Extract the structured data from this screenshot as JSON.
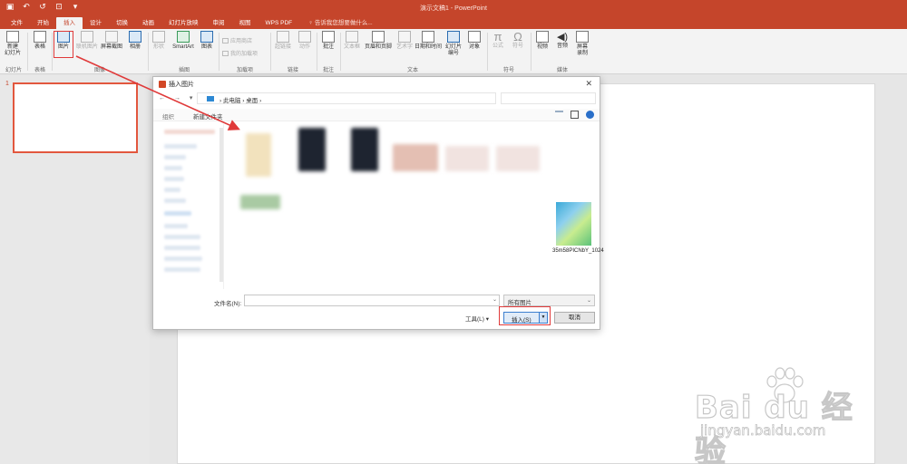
{
  "titlebar": {
    "title": "演示文稿1 - PowerPoint",
    "qat": [
      "save-icon",
      "undo-icon",
      "redo-icon",
      "start-icon",
      "customize-icon"
    ]
  },
  "tabs": [
    "文件",
    "开始",
    "插入",
    "设计",
    "切换",
    "动画",
    "幻灯片放映",
    "审阅",
    "视图",
    "WPS PDF"
  ],
  "active_tab": "插入",
  "tell_me": "告诉我您想要做什么...",
  "ribbon": {
    "new_slide": "新建\n幻灯片",
    "table": "表格",
    "picture": "图片",
    "online_pictures": "联机图片",
    "screenshot": "屏幕截图",
    "album": "相册",
    "shapes": "形状",
    "smartart": "SmartArt",
    "chart": "图表",
    "store": "应用商店",
    "my_addins": "我的加载项",
    "hyperlink": "超链接",
    "action": "动作",
    "comment": "批注",
    "textbox": "文本框",
    "header_footer": "页眉和页脚",
    "wordart": "艺术字",
    "datetime": "日期和时间",
    "slide_number": "幻灯片\n编号",
    "object": "对象",
    "equation": "公式",
    "symbol": "符号",
    "video": "视频",
    "audio": "音频",
    "screen_recording": "屏幕\n录制",
    "groups": {
      "slides": "幻灯片",
      "tables": "表格",
      "images": "图像",
      "illustrations": "插图",
      "addins": "加载项",
      "links": "链接",
      "comments": "批注",
      "text": "文本",
      "symbols": "符号",
      "media": "媒体"
    }
  },
  "slide_panel": {
    "number": "1"
  },
  "dialog": {
    "title": "插入图片",
    "breadcrumb": [
      "此电脑",
      "桌面"
    ],
    "organize": "组织",
    "new_folder": "新建文件夹",
    "clear_file": "35m58PICNbY_1024",
    "filename_label": "文件名(N):",
    "filename_value": "",
    "filetype": "所有图片",
    "tools": "工具(L)",
    "insert": "插入(S)",
    "cancel": "取消"
  },
  "watermark": {
    "main": "Bai du 经验",
    "sub": "jingyan.baidu.com"
  },
  "colors": {
    "accent": "#c5452b",
    "highlight": "#e03a3a",
    "ribbon_bg": "#f3f3f3"
  }
}
